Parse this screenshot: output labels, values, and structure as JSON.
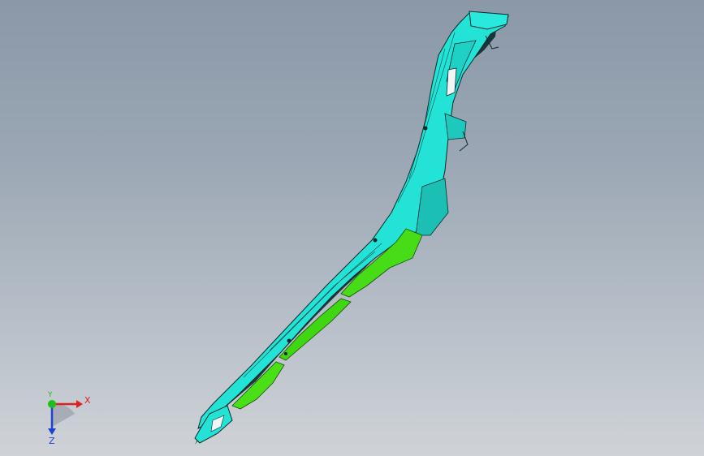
{
  "viewport": {
    "background_top": "#8a98a8",
    "background_bottom": "#cfd3d8"
  },
  "model": {
    "primary_color": "#22e3d6",
    "secondary_color": "#47dd16",
    "edge_color": "#0b2a2a",
    "highlight_color": "#f1f5f6"
  },
  "triad": {
    "x_label": "X",
    "y_label": "Y",
    "z_label": "Z",
    "x_color": "#e02020",
    "y_color": "#18c018",
    "z_color": "#2040d0"
  }
}
